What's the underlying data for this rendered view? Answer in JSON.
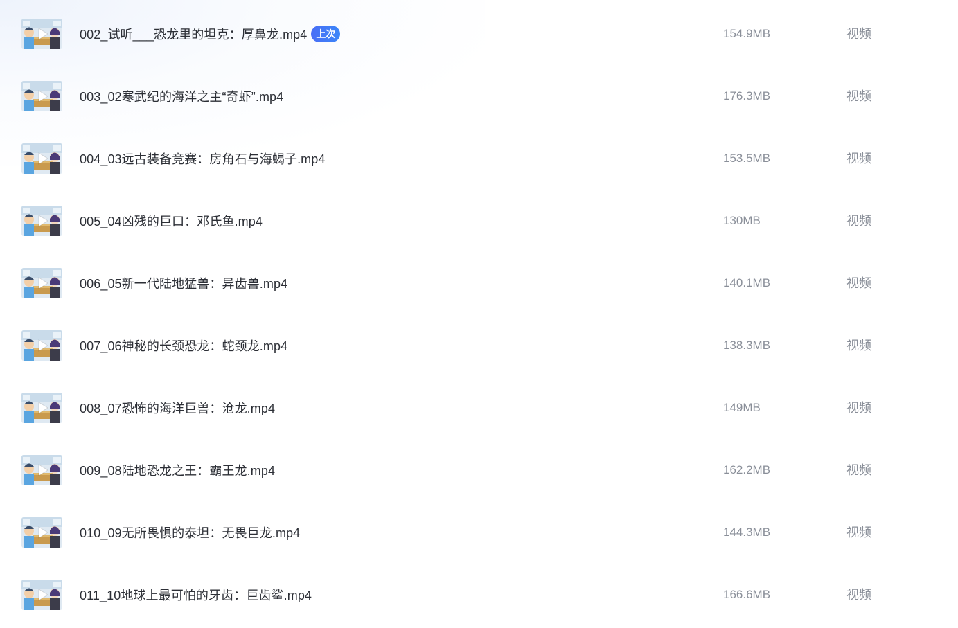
{
  "file_list": {
    "items": [
      {
        "title": "002_试听___恐龙里的坦克：厚鼻龙.mp4",
        "badge": "上次",
        "size": "154.9MB",
        "type": "视频"
      },
      {
        "title": "003_02寒武纪的海洋之主“奇虾”.mp4",
        "badge": "",
        "size": "176.3MB",
        "type": "视频"
      },
      {
        "title": "004_03远古装备竞赛：房角石与海蝎子.mp4",
        "badge": "",
        "size": "153.5MB",
        "type": "视频"
      },
      {
        "title": "005_04凶残的巨口：邓氏鱼.mp4",
        "badge": "",
        "size": "130MB",
        "type": "视频"
      },
      {
        "title": "006_05新一代陆地猛兽：异齿兽.mp4",
        "badge": "",
        "size": "140.1MB",
        "type": "视频"
      },
      {
        "title": "007_06神秘的长颈恐龙：蛇颈龙.mp4",
        "badge": "",
        "size": "138.3MB",
        "type": "视频"
      },
      {
        "title": "008_07恐怖的海洋巨兽：沧龙.mp4",
        "badge": "",
        "size": "149MB",
        "type": "视频"
      },
      {
        "title": "009_08陆地恐龙之王：霸王龙.mp4",
        "badge": "",
        "size": "162.2MB",
        "type": "视频"
      },
      {
        "title": "010_09无所畏惧的泰坦：无畏巨龙.mp4",
        "badge": "",
        "size": "144.3MB",
        "type": "视频"
      },
      {
        "title": "011_10地球上最可怕的牙齿：巨齿鲨.mp4",
        "badge": "",
        "size": "166.6MB",
        "type": "视频"
      }
    ]
  },
  "icons": {
    "thumbnail": "video-thumbnail",
    "play": "play-icon"
  },
  "colors": {
    "badge_start": "#4a6ef6",
    "badge_end": "#3b86f8",
    "title_text": "#2c2f36",
    "meta_text": "#8a8f99"
  }
}
